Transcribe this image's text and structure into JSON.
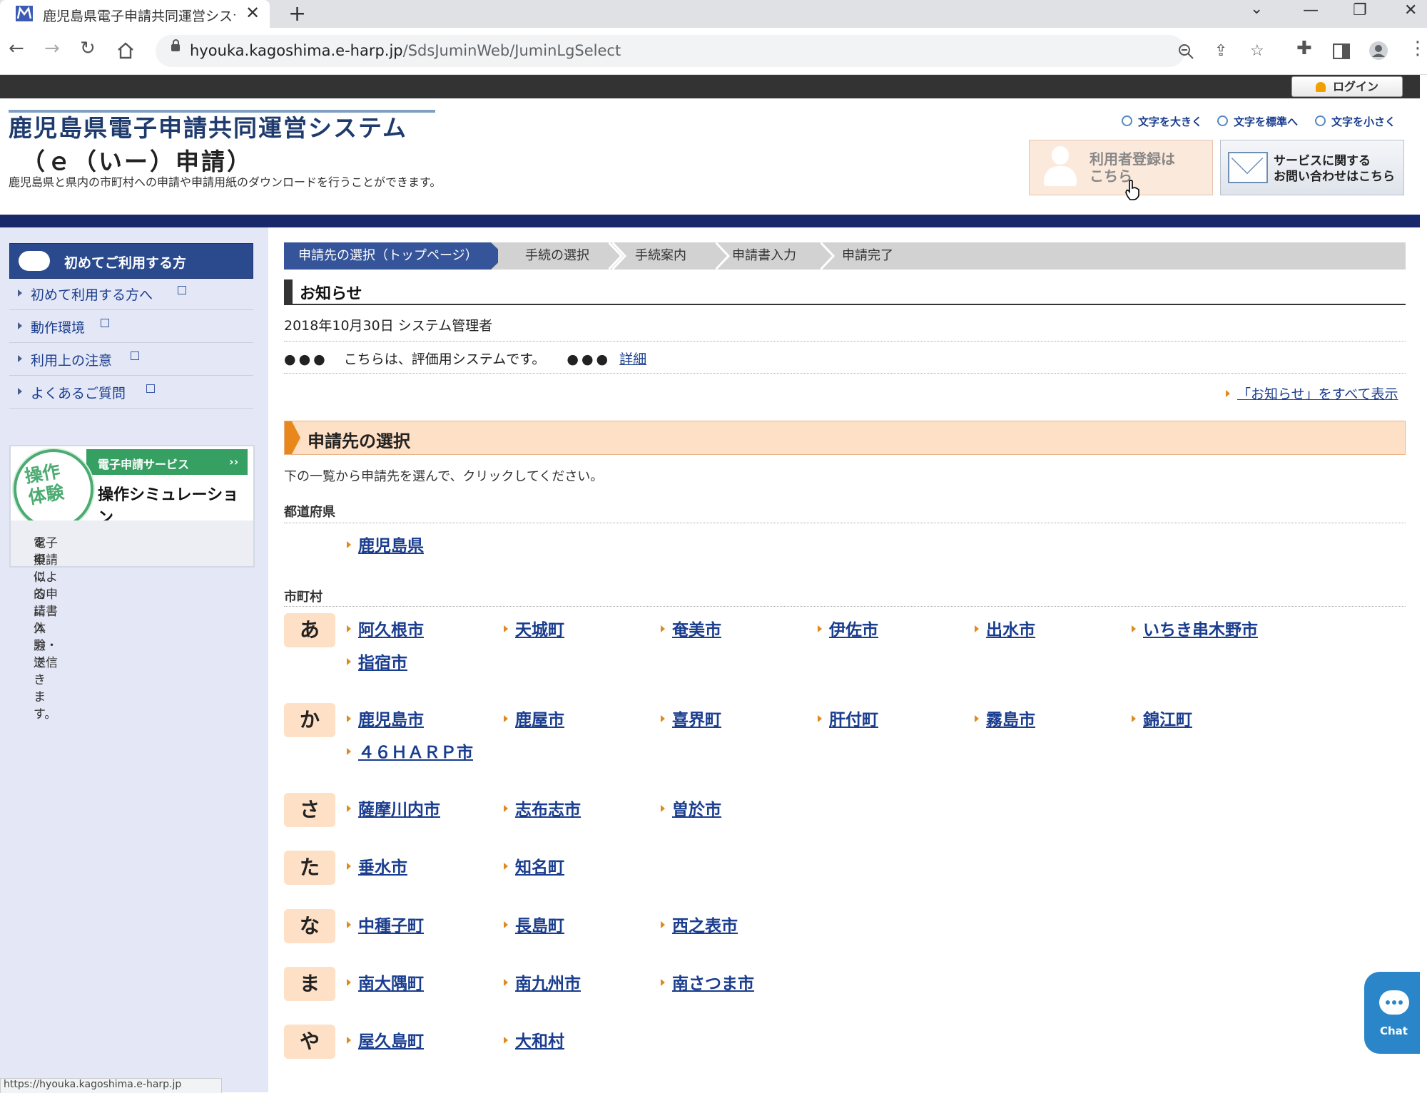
{
  "browser": {
    "tab_title": "鹿児島県電子申請共同運営システ",
    "url_host": "hyouka.kagoshima.e-harp.jp",
    "url_path": "/SdsJuminWeb/JuminLgSelect",
    "status_url": "https://hyouka.kagoshima.e-harp.jp"
  },
  "header": {
    "login_label": "ログイン",
    "title_line1": "鹿児島県電子申請共同運営システム",
    "title_line2": "（ｅ（いー）申請）",
    "subtitle": "鹿児島県と県内の市町村への申請や申請用紙のダウンロードを行うことができます。",
    "font_larger": "文字を大きく",
    "font_standard": "文字を標準へ",
    "font_smaller": "文字を小さく",
    "register_line1": "利用者登録は",
    "register_line2": "こちら",
    "contact_line1": "サービスに関する",
    "contact_line2": "お問い合わせはこちら"
  },
  "sidebar": {
    "heading": "初めてご利用する方",
    "links": [
      {
        "label": "初めて利用する方へ"
      },
      {
        "label": "動作環境"
      },
      {
        "label": "利用上の注意"
      },
      {
        "label": "よくあるご質問"
      }
    ],
    "sim_badge": "操作体験",
    "sim_service": "電子申請サービス",
    "sim_title": "操作シミュレーション",
    "sim_desc_line1": "電子申請による申請書入力・送信",
    "sim_desc_line2": "を擬似的に体験できます。"
  },
  "steps": [
    "申請先の選択（トップページ）",
    "手続の選択",
    "手続案内",
    "申請書入力",
    "申請完了"
  ],
  "notice": {
    "heading": "お知らせ",
    "date_author": "2018年10月30日 システム管理者",
    "dots": "●●●",
    "body": "こちらは、評価用システムです。",
    "detail_link": "詳細",
    "all_link": "「お知らせ」をすべて表示"
  },
  "select": {
    "heading": "申請先の選択",
    "instruction": "下の一覧から申請先を選んで、クリックしてください。",
    "prefecture_label": "都道府県",
    "prefecture": "鹿児島県",
    "municipality_label": "市町村",
    "groups": [
      {
        "kana": "あ",
        "cities": [
          "阿久根市",
          "天城町",
          "奄美市",
          "伊佐市",
          "出水市",
          "いちき串木野市",
          "指宿市"
        ]
      },
      {
        "kana": "か",
        "cities": [
          "鹿児島市",
          "鹿屋市",
          "喜界町",
          "肝付町",
          "霧島市",
          "錦江町",
          "４６ＨＡＲＰ市"
        ]
      },
      {
        "kana": "さ",
        "cities": [
          "薩摩川内市",
          "志布志市",
          "曽於市"
        ]
      },
      {
        "kana": "た",
        "cities": [
          "垂水市",
          "知名町"
        ]
      },
      {
        "kana": "な",
        "cities": [
          "中種子町",
          "長島町",
          "西之表市"
        ]
      },
      {
        "kana": "ま",
        "cities": [
          "南大隅町",
          "南九州市",
          "南さつま市"
        ]
      },
      {
        "kana": "や",
        "cities": [
          "屋久島町",
          "大和村"
        ]
      }
    ]
  },
  "chat_label": "Chat",
  "icons": [
    "favicon",
    "close-icon",
    "plus-icon",
    "back-icon",
    "forward-icon",
    "reload-icon",
    "home-icon",
    "lock-icon",
    "zoom-icon",
    "share-icon",
    "star-icon",
    "extensions-icon",
    "sidepanel-icon",
    "profile-icon",
    "menu-icon",
    "magnifier-icon",
    "user-icon",
    "envelope-icon",
    "pointing-hand-icon",
    "chat-icon"
  ]
}
